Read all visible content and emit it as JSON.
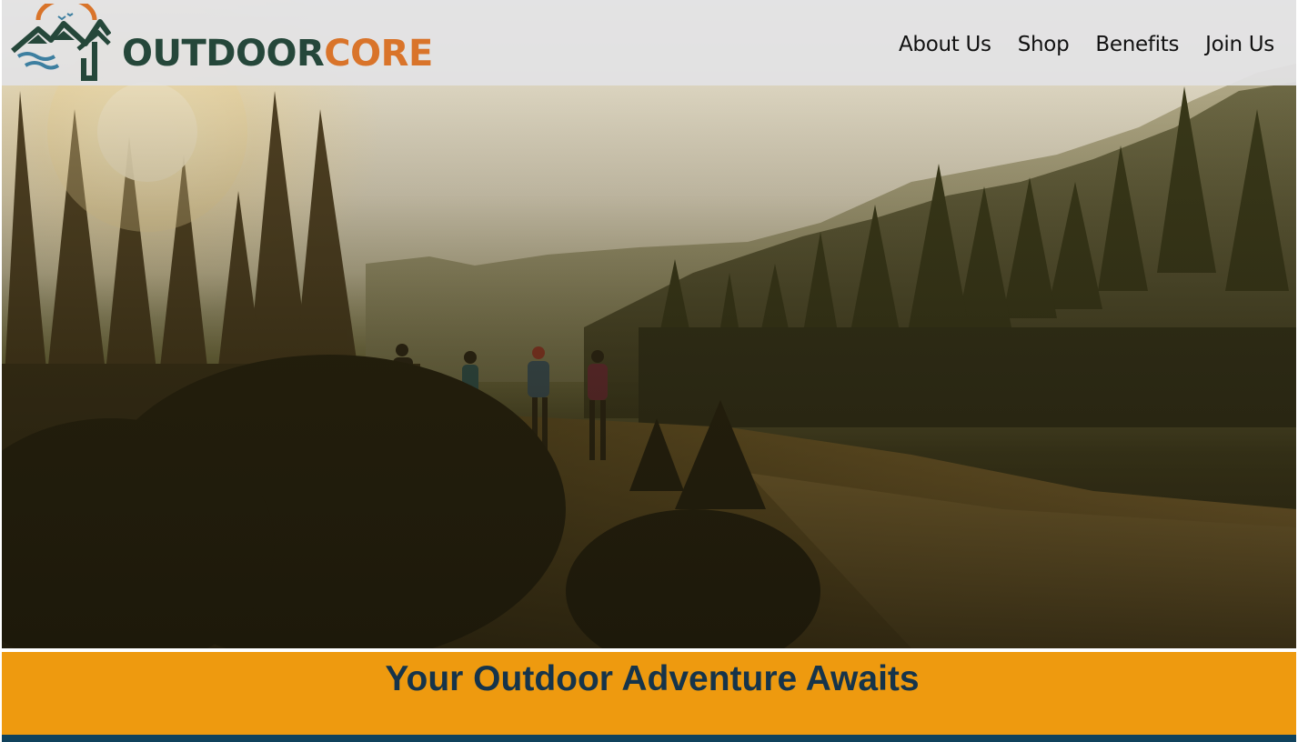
{
  "brand": {
    "name_part1": "OUTDOOR",
    "name_part2": "CORE",
    "logo_icon": "mountain-cabin-logo-icon"
  },
  "nav": {
    "items": [
      {
        "label": "About Us"
      },
      {
        "label": "Shop"
      },
      {
        "label": "Benefits"
      },
      {
        "label": "Join Us"
      }
    ]
  },
  "hero": {
    "image": "hikers-in-sunlit-mountain-forest"
  },
  "banner": {
    "headline": "Your Outdoor Adventure Awaits"
  },
  "colors": {
    "brand_green": "#25473a",
    "brand_orange": "#d9742a",
    "banner_bg": "#ee9a0f",
    "headline_text": "#16344a",
    "footer_bar": "#10425c",
    "header_bg": "#e2e2e4"
  }
}
